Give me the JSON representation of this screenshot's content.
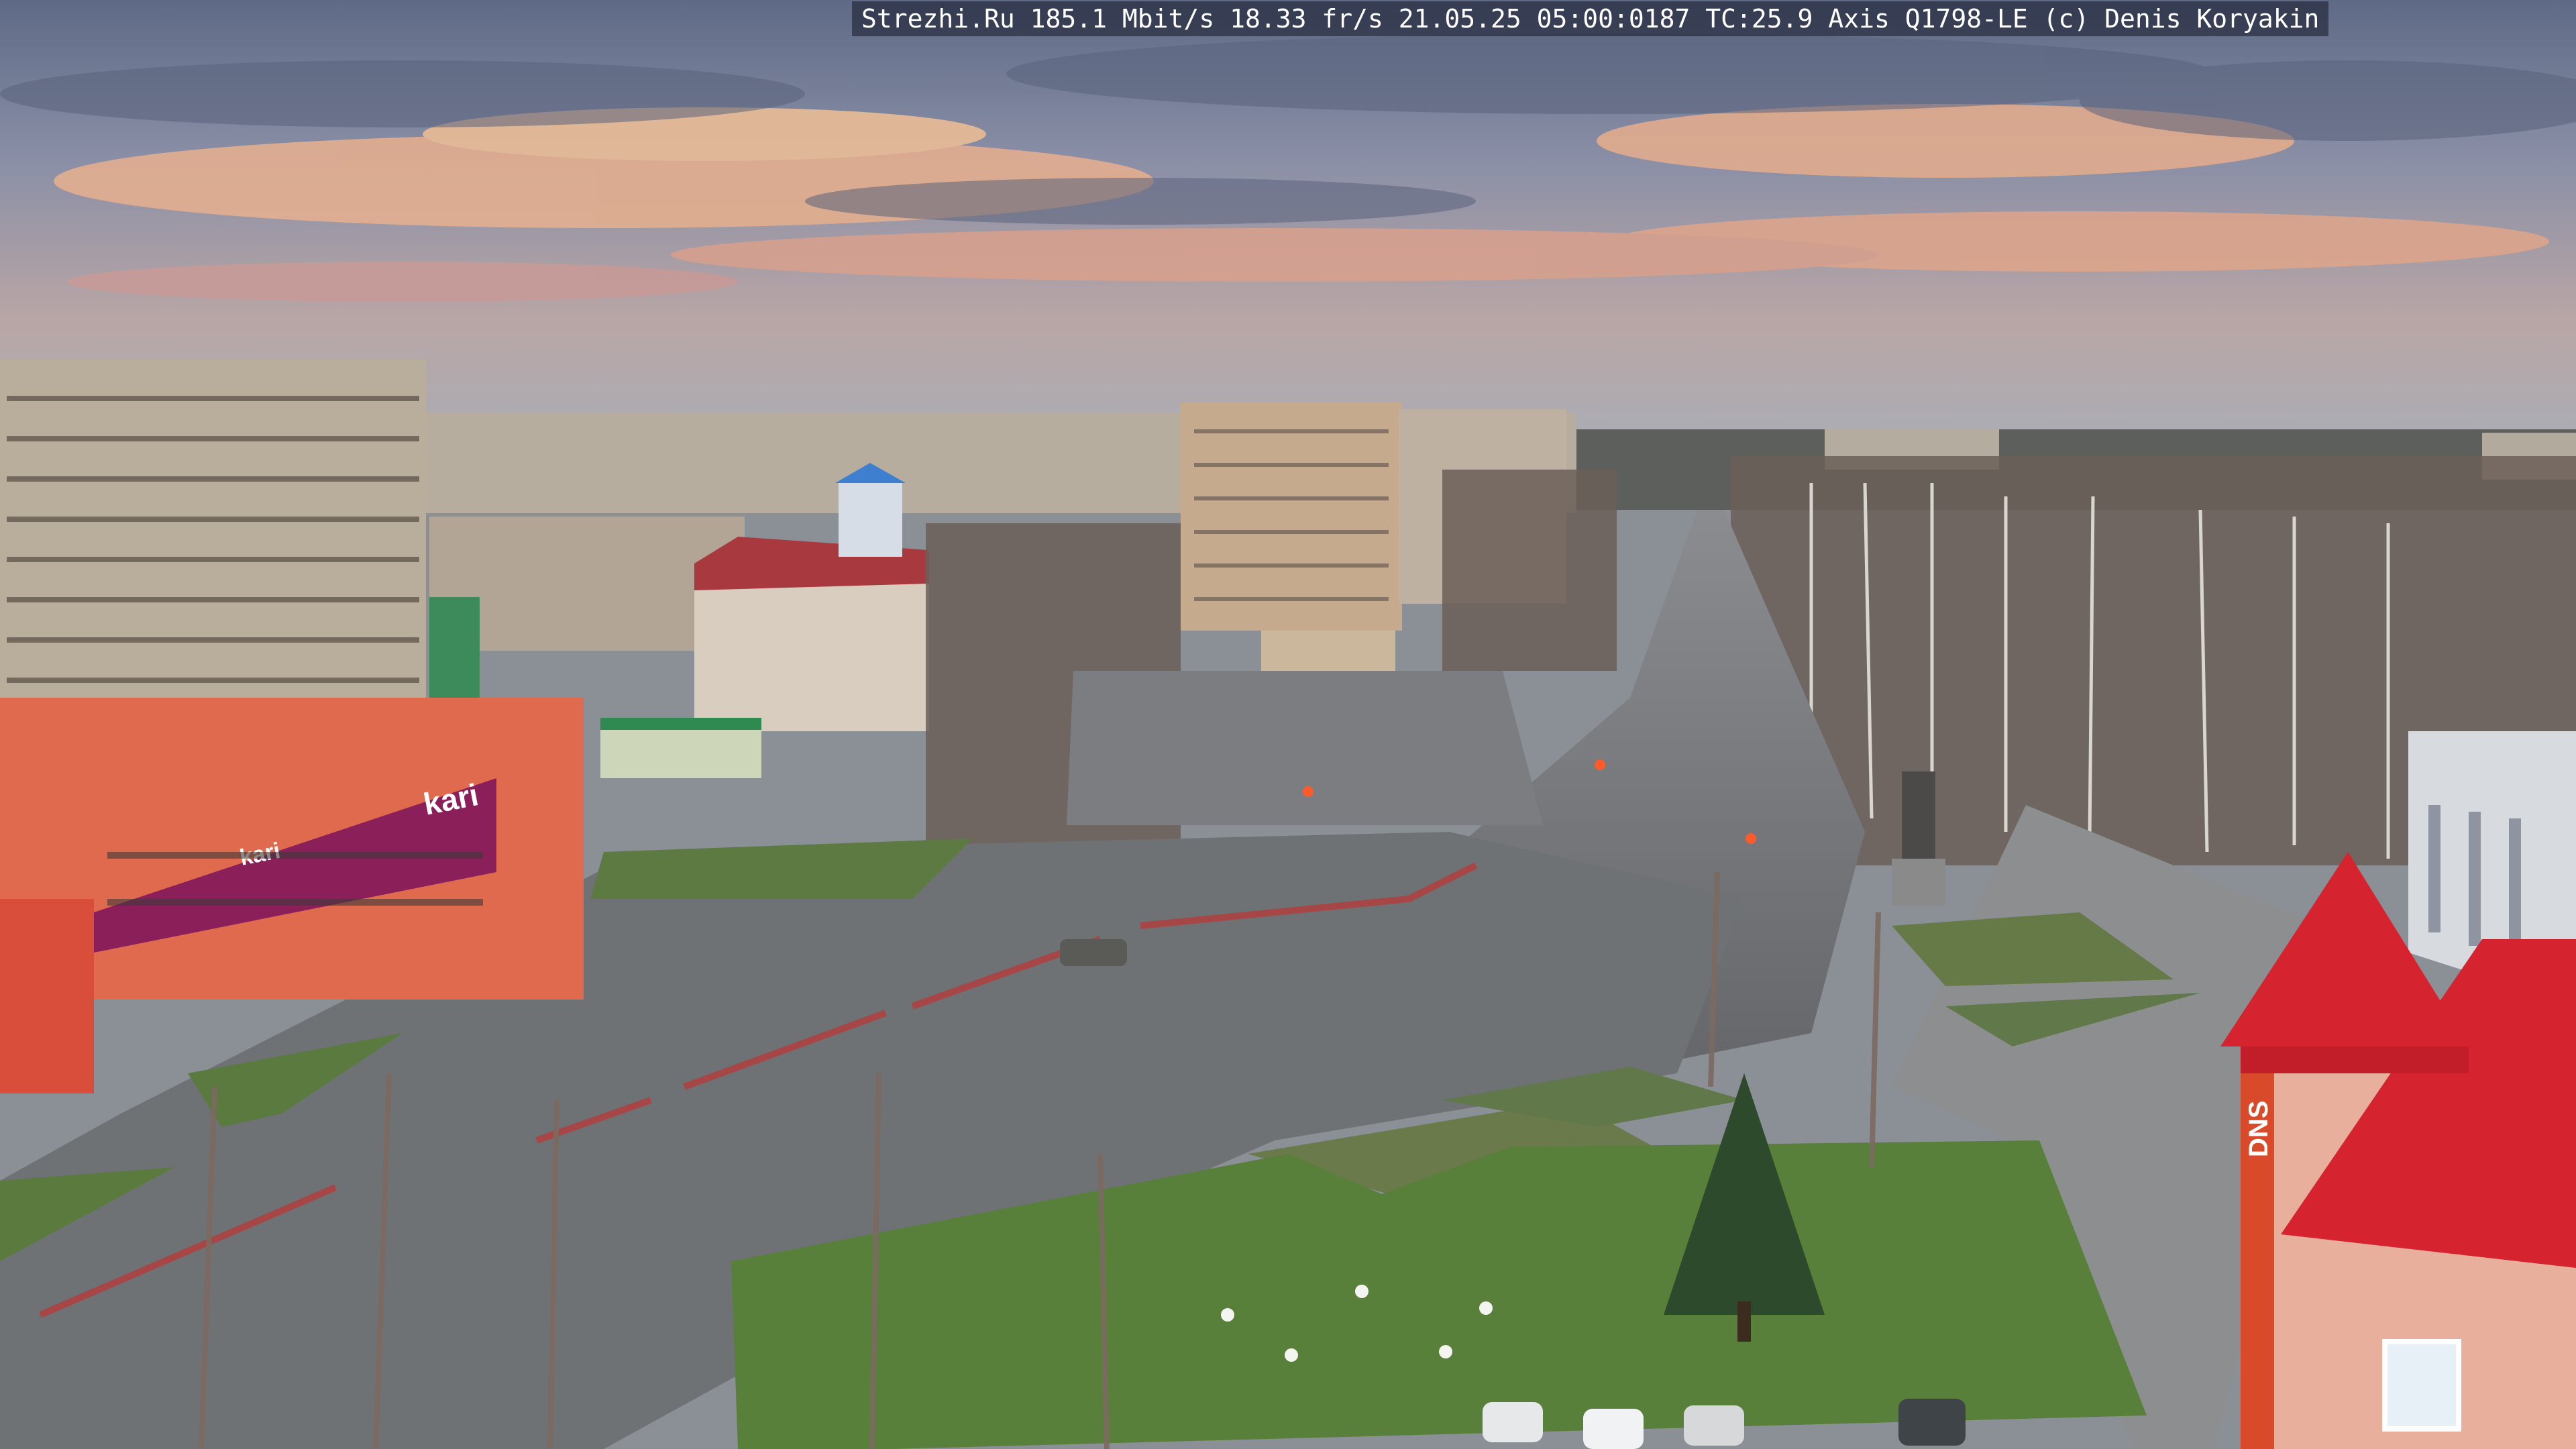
{
  "overlay": {
    "text": "Strezhi.Ru 185.1 Mbit/s 18.33 fr/s 21.05.25 05:00:0187 TC:25.9  Axis Q1798-LE  (c) Denis Koryakin"
  },
  "signs": {
    "kari_large": "kari",
    "kari_small": "kari",
    "dns": "DNS"
  },
  "colors": {
    "sky_top": "#6f7a94",
    "sky_glow": "#e8b08e",
    "asphalt": "#6d7074",
    "grass": "#5c7a3a",
    "roof_red": "#d5232f",
    "kari_banner": "#8a1f5a",
    "shop_orange": "#e06a4e"
  }
}
